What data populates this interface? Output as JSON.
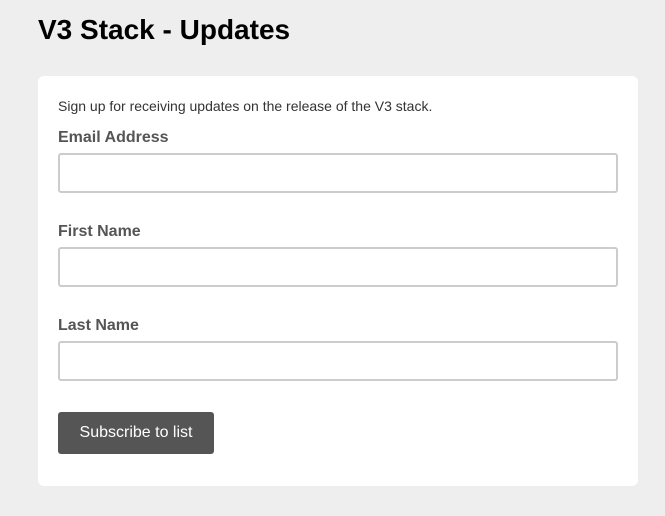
{
  "page": {
    "title": "V3 Stack - Updates"
  },
  "form": {
    "intro": "Sign up for receiving updates on the release of the V3 stack.",
    "fields": [
      {
        "label": "Email Address",
        "value": "",
        "placeholder": ""
      },
      {
        "label": "First Name",
        "value": "",
        "placeholder": ""
      },
      {
        "label": "Last Name",
        "value": "",
        "placeholder": ""
      }
    ],
    "submit_label": "Subscribe to list"
  },
  "colors": {
    "page_background": "#eeeeee",
    "card_background": "#ffffff",
    "button_background": "#555555",
    "button_text": "#ffffff",
    "label_text": "#555555",
    "input_border": "#cccccc"
  }
}
